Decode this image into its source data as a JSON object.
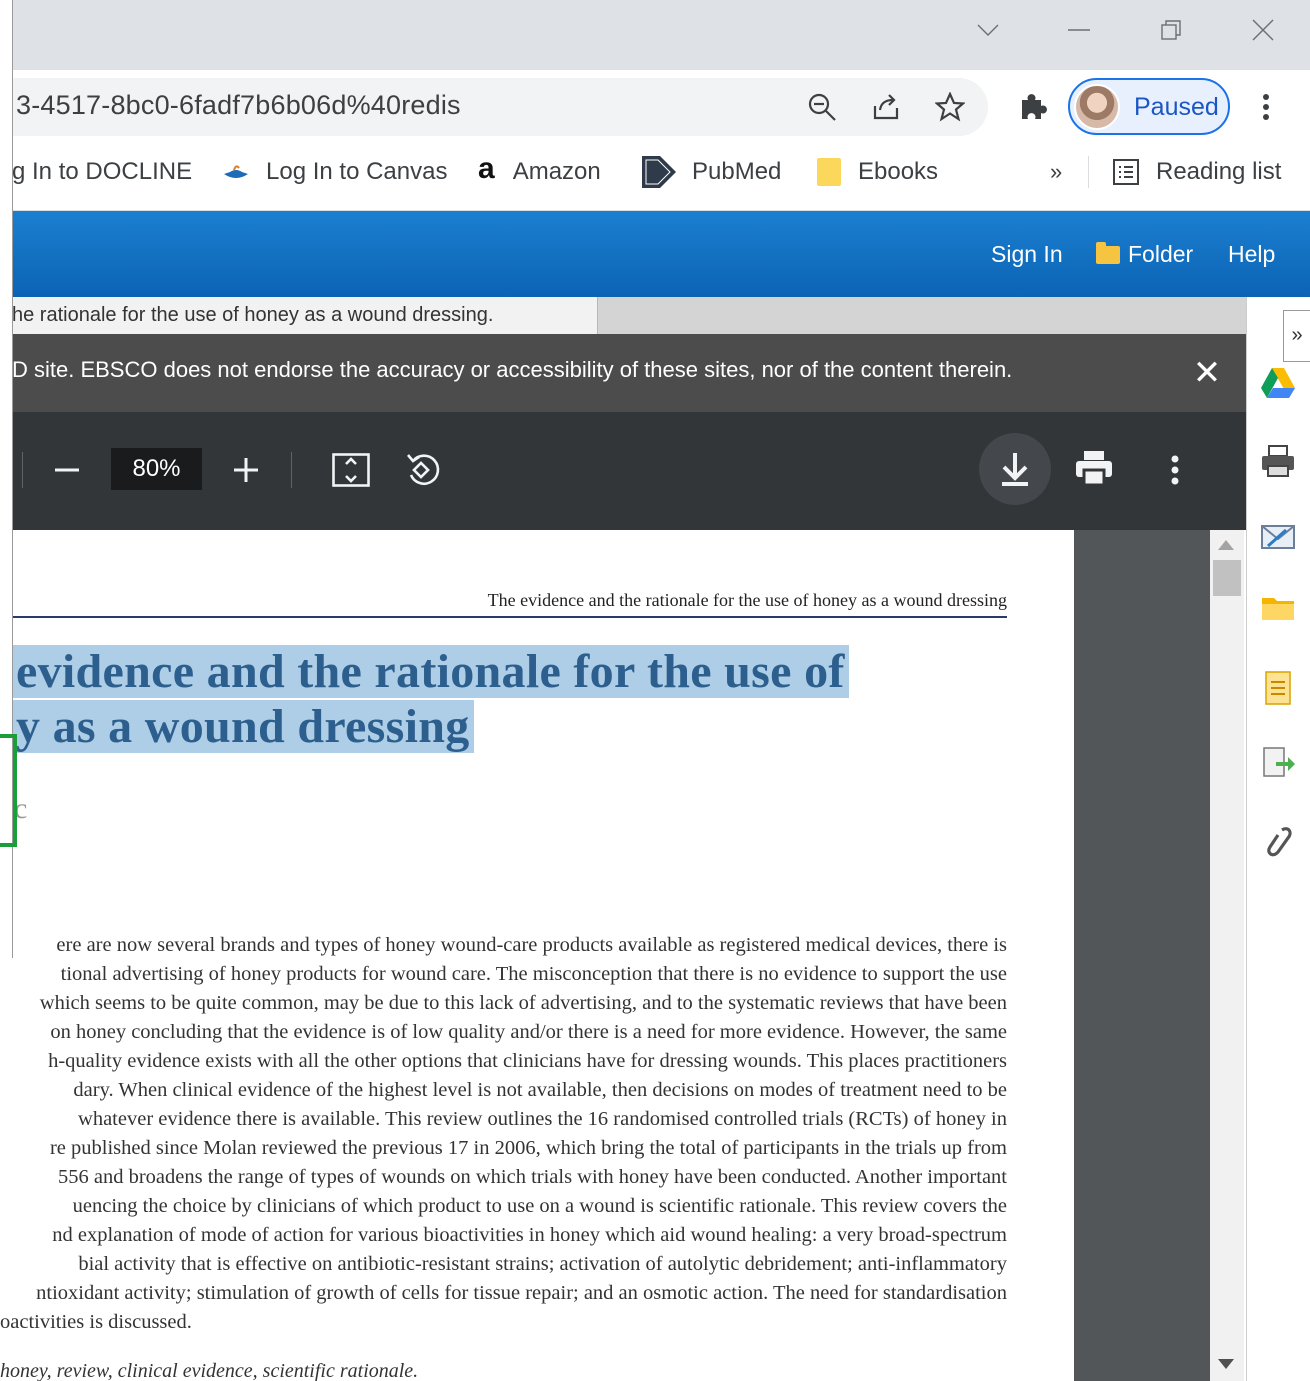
{
  "browser": {
    "url": "3-4517-8bc0-6fadf7b6b06d%40redis",
    "profile_label": "Paused",
    "bookmarks": [
      {
        "label": "g In to DOCLINE",
        "icon": "none"
      },
      {
        "label": "Log In to Canvas",
        "icon": "canvas-lamp-icon"
      },
      {
        "label": "Amazon",
        "icon": "amazon-a-icon"
      },
      {
        "label": "PubMed",
        "icon": "pubmed-icon"
      },
      {
        "label": "Ebooks",
        "icon": "folder-icon"
      }
    ],
    "overflow_label": "»",
    "reading_list_label": "Reading list"
  },
  "site": {
    "nav": {
      "sign_in": "Sign In",
      "folder": "Folder",
      "help": "Help"
    },
    "tab_title": "he rationale for the use of honey as a wound dressing.",
    "notice_text": "D site. EBSCO does not endorse the accuracy or accessibility of these sites, nor of the content therein.",
    "notice_close": "✕",
    "tools_collapse": "»",
    "tools": [
      "google-drive-icon",
      "print-icon",
      "email-icon",
      "save-folder-icon",
      "cite-icon",
      "export-icon",
      "permalink-icon"
    ]
  },
  "pdf": {
    "zoom": "80%",
    "running_head": "The evidence and the rationale for the use of honey as a wound dressing",
    "title_lines": [
      "evidence and the rationale for the use of",
      "y as a wound dressing"
    ],
    "fragment_c": "c",
    "abstract_lines": [
      "ere are now several brands and types of honey wound-care products available as registered medical devices, there is",
      "tional advertising of honey products for wound care. The misconception that there is no evidence to support the use",
      "which seems to be quite common, may be due to this lack of advertising, and to the systematic reviews that have been",
      "on honey concluding that the evidence is of low quality and/or there is a need for more evidence. However, the same",
      "h-quality evidence exists with all the other options that clinicians have for dressing wounds. This places practitioners",
      "dary. When clinical evidence of the highest level is not available, then decisions on modes of treatment need to be",
      "whatever evidence there is available. This review outlines the 16 randomised controlled trials (RCTs) of honey in",
      "re published since Molan reviewed the previous 17 in 2006, which bring the total of participants in the trials up from",
      "556 and broadens the range of types of wounds on which trials with honey have been conducted. Another important",
      "uencing the choice by clinicians of which product to use on a wound is scientific rationale. This review covers the",
      "nd explanation of mode of action for various bioactivities in honey which aid wound healing: a very broad-spectrum",
      "bial activity that is effective on antibiotic-resistant strains; activation of autolytic debridement; anti-inflammatory",
      "ntioxidant activity; stimulation of growth of cells for tissue repair; and an osmotic action. The need for standardisation",
      "oactivities is discussed."
    ],
    "keywords": "honey, review, clinical evidence, scientific rationale."
  }
}
